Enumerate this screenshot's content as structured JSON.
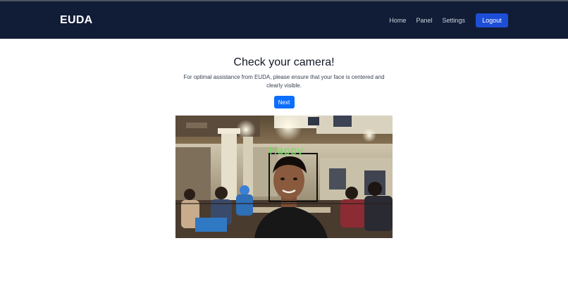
{
  "navbar": {
    "brand": "EUDA",
    "links": [
      "Home",
      "Panel",
      "Settings"
    ],
    "logout_label": "Logout"
  },
  "main": {
    "title": "Check your camera!",
    "description": "For optimal assistance from EUDA, please ensure that your face is centered and clearly visible.",
    "next_label": "Next"
  },
  "camera": {
    "emotion_label": "Happy",
    "label_color": "#6ee05a",
    "box_color": "#111111"
  },
  "colors": {
    "navbar_bg": "#111c36",
    "logout_bg": "#1d4ed8",
    "next_bg": "#0d6efd"
  }
}
